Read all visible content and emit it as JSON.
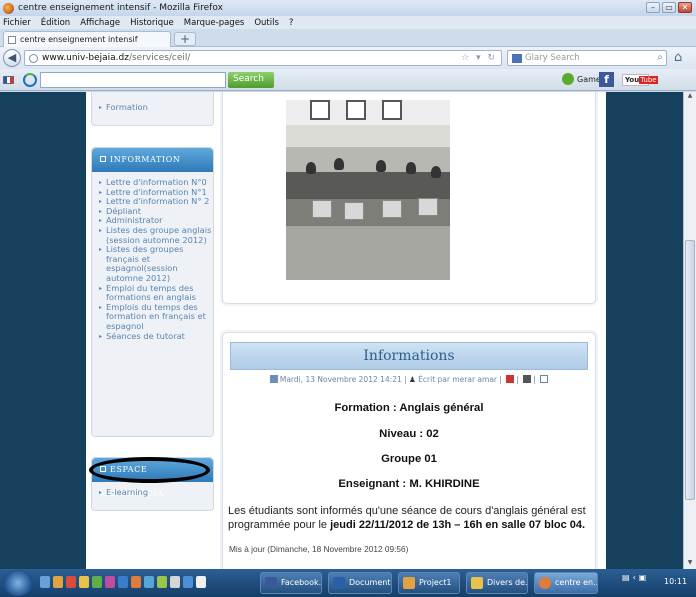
{
  "window": {
    "title": "centre enseignement intensif - Mozilla Firefox",
    "buttons": [
      "–",
      "▭",
      "✕"
    ]
  },
  "menubar": [
    "Fichier",
    "Édition",
    "Affichage",
    "Historique",
    "Marque-pages",
    "Outils",
    "?"
  ],
  "tab": {
    "label": "centre enseignement intensif",
    "new_tab": "+"
  },
  "nav": {
    "url_host": "www.univ-bejaia.dz",
    "url_path": "/services/ceil/",
    "url_prefix": "",
    "search_placeholder": "Glary Search"
  },
  "toolbar": {
    "search_button": "Search",
    "games_label": "Games",
    "fb": "f",
    "yt_you": "You",
    "yt_tube": "Tube"
  },
  "sidebar": {
    "top_item": "Formation",
    "information_title": "INFORMATION",
    "information_items": [
      "Lettre d'information N°0",
      "Lettre d'information N°1",
      "Lettre d'information N° 2",
      "Dépliant",
      "Administrator",
      "Listes des groupe anglais (session automne 2012)",
      "Listes des groupes français et espagnol(session automne 2012)",
      "Emploi du temps des formations en anglais",
      "Emplois du temps des formation en français et espagnol",
      "Séances de tutorat"
    ],
    "multimedia_title": "ESPACE MULTIMÉDIA",
    "multimedia_items": [
      "E-learning"
    ]
  },
  "article": {
    "heading": "Informations",
    "meta_date": "Mardi, 13 Novembre 2012 14:21",
    "meta_author": "Écrit par merar amar",
    "formation": "Formation : Anglais général",
    "niveau": "Niveau : 02",
    "groupe": "Groupe 01",
    "enseignant": "Enseignant : M. KHIRDINE",
    "para_1": "Les étudiants sont informés qu'une séance de cours d'anglais général est programmée pour le ",
    "para_bold": "jeudi 22/11/2012 de 13h – 16h  en salle 07 bloc 04.",
    "updated": "Mis à jour (Dimanche, 18 Novembre 2012 09:56)"
  },
  "taskbar": {
    "tasks": [
      "Facebook...",
      "Document...",
      "Project1",
      "Divers de...",
      "centre en..."
    ],
    "clock": "10:11"
  }
}
